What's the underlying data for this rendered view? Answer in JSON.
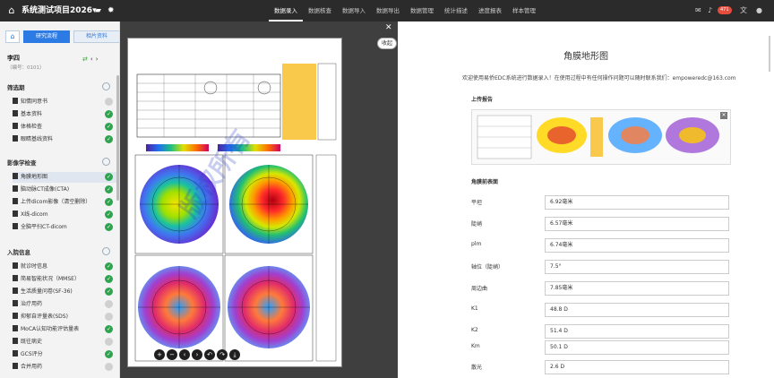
{
  "app": {
    "title": "系统测试项目2026",
    "title_arrow": "▾"
  },
  "nav": {
    "items": [
      {
        "label": "数据录入",
        "active": true
      },
      {
        "label": "数据核查",
        "active": false
      },
      {
        "label": "数据导入",
        "active": false
      },
      {
        "label": "数据导出",
        "active": false
      },
      {
        "label": "数据管理",
        "active": false
      },
      {
        "label": "统计描述",
        "active": false
      },
      {
        "label": "进度报表",
        "active": false
      },
      {
        "label": "样本管理",
        "active": false
      }
    ],
    "notification_count": "471"
  },
  "sidebar": {
    "tabs": [
      {
        "label": "研究流程",
        "active": true
      },
      {
        "label": "相片资料",
        "active": false
      }
    ],
    "patient_name": "李四",
    "patient_id": "（编号：0101）",
    "groups": [
      {
        "label": "筛选期",
        "items": [
          {
            "label": "知情同意书",
            "status": "pending"
          },
          {
            "label": "基本资料",
            "status": "done"
          },
          {
            "label": "体格检查",
            "status": "done"
          },
          {
            "label": "眼睛基线资料",
            "status": "done"
          }
        ]
      },
      {
        "label": "影像学检查",
        "items": [
          {
            "label": "角膜地形图",
            "status": "done",
            "selected": true
          },
          {
            "label": "脑动脉CT成像(CTA)",
            "status": "done"
          },
          {
            "label": "上传dicom影像（清空删除）",
            "status": "done"
          },
          {
            "label": "X线-dicom",
            "status": "done"
          },
          {
            "label": "全脑平扫CT-dicom",
            "status": "done"
          }
        ]
      },
      {
        "label": "入院信息",
        "items": [
          {
            "label": "就诊时信息",
            "status": "done"
          },
          {
            "label": "简易智能状况（MMSE）",
            "status": "done"
          },
          {
            "label": "生活质量问卷(SF-36)",
            "status": "done"
          },
          {
            "label": "治疗用药",
            "status": "pending"
          },
          {
            "label": "抑郁自评量表(SDS)",
            "status": "pending"
          },
          {
            "label": "MoCA认知功能评估量表",
            "status": "done"
          },
          {
            "label": "既往病史",
            "status": "pending"
          },
          {
            "label": "GCS评分",
            "status": "done"
          },
          {
            "label": "合并用药",
            "status": "pending"
          }
        ]
      }
    ]
  },
  "viewer": {
    "collapse_label": "收起",
    "toolbar": [
      "+",
      "−",
      "‹",
      "›",
      "↶",
      "↷",
      "⤓"
    ]
  },
  "form": {
    "title": "角膜地形图",
    "welcome": "欢迎使用易侨EDC系统进行数据录入！在使用过程中有任何操作问题可以随时联系我们：empoweredc@163.com",
    "upload_section": "上传报告",
    "values_section": "角膜前表面",
    "fields": [
      {
        "label": "平坦",
        "value": "6.92毫米"
      },
      {
        "label": "陡峭",
        "value": "6.57毫米"
      },
      {
        "label": "plm",
        "value": "6.74毫米"
      },
      {
        "label": "轴位（陡峭）",
        "value": "7.5°"
      },
      {
        "label": "周边曲",
        "value": "7.85毫米"
      },
      {
        "label": "K1",
        "value": "48.8 D"
      },
      {
        "label": "K2",
        "value": "51.4 D"
      },
      {
        "label": "Km",
        "value": "50.1 D"
      },
      {
        "label": "散光",
        "value": "2.6 D"
      }
    ]
  },
  "colors": {
    "topbar": "#2b2b2b",
    "accent": "#2c7be5",
    "done": "#2ea44f",
    "badge": "#e74c3c"
  }
}
